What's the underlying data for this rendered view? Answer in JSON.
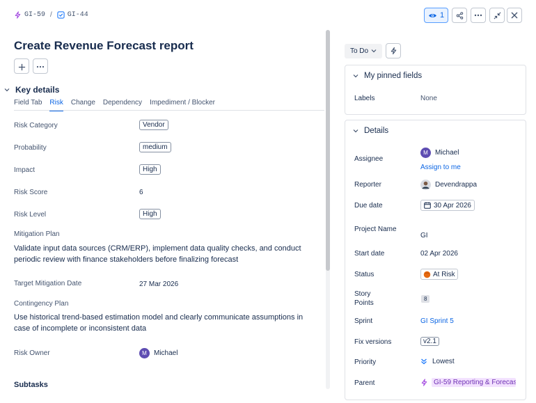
{
  "breadcrumb": {
    "parent_key": "GI-59",
    "issue_key": "GI-44",
    "separator": "/"
  },
  "header": {
    "watch_count": "1"
  },
  "issue": {
    "title": "Create Revenue Forecast report"
  },
  "key_details": {
    "heading": "Key details",
    "tabs": [
      {
        "label": "Field Tab"
      },
      {
        "label": "Risk"
      },
      {
        "label": "Change"
      },
      {
        "label": "Dependency"
      },
      {
        "label": "Impediment / Blocker"
      }
    ],
    "active_tab": "Risk",
    "fields": {
      "risk_category": {
        "label": "Risk Category",
        "value": "Vendor"
      },
      "probability": {
        "label": "Probability",
        "value": "medium"
      },
      "impact": {
        "label": "Impact",
        "value": "High"
      },
      "risk_score": {
        "label": "Risk Score",
        "value": "6"
      },
      "risk_level": {
        "label": "Risk Level",
        "value": "High"
      },
      "mitigation_plan": {
        "label": "Mitigation Plan",
        "line1": "Validate input data sources (CRM/ERP), implement data quality checks, and conduct",
        "line2": "periodic review with finance stakeholders before finalizing forecast"
      },
      "target_mitigation_date": {
        "label": "Target Mitigation Date",
        "value": "27 Mar 2026"
      },
      "contingency_plan": {
        "label": "Contingency Plan",
        "line1": "Use historical trend-based estimation model and clearly communicate assumptions in",
        "line2": "case of incomplete or inconsistent data"
      },
      "risk_owner": {
        "label": "Risk Owner",
        "value": "Michael",
        "avatar": "M"
      }
    }
  },
  "subtasks": {
    "heading": "Subtasks"
  },
  "side": {
    "status": "To Do",
    "pinned": {
      "heading": "My pinned fields",
      "labels_label": "Labels",
      "labels_value": "None"
    },
    "details": {
      "heading": "Details",
      "assignee_label": "Assignee",
      "assignee_value": "Michael",
      "assignee_avatar": "M",
      "assign_to_me": "Assign to me",
      "reporter_label": "Reporter",
      "reporter_value": "Devendrappa",
      "due_label": "Due date",
      "due_value": "30 Apr 2026",
      "project_label": "Project Name",
      "project_value": "GI",
      "start_label": "Start date",
      "start_value": "02 Apr 2026",
      "status_label": "Status",
      "status_value": "At Risk",
      "points_label_1": "Story",
      "points_label_2": "Points",
      "points_value": "8",
      "sprint_label": "Sprint",
      "sprint_value": "GI Sprint 5",
      "fix_label": "Fix versions",
      "fix_value": "v2.1",
      "priority_label": "Priority",
      "priority_value": "Lowest",
      "parent_label": "Parent",
      "parent_value": "GI-59 Reporting & Forecas"
    }
  },
  "colors": {
    "accent": "#0c66e4",
    "epic_purple": "#a54ee1",
    "status_orange": "#e56910"
  }
}
